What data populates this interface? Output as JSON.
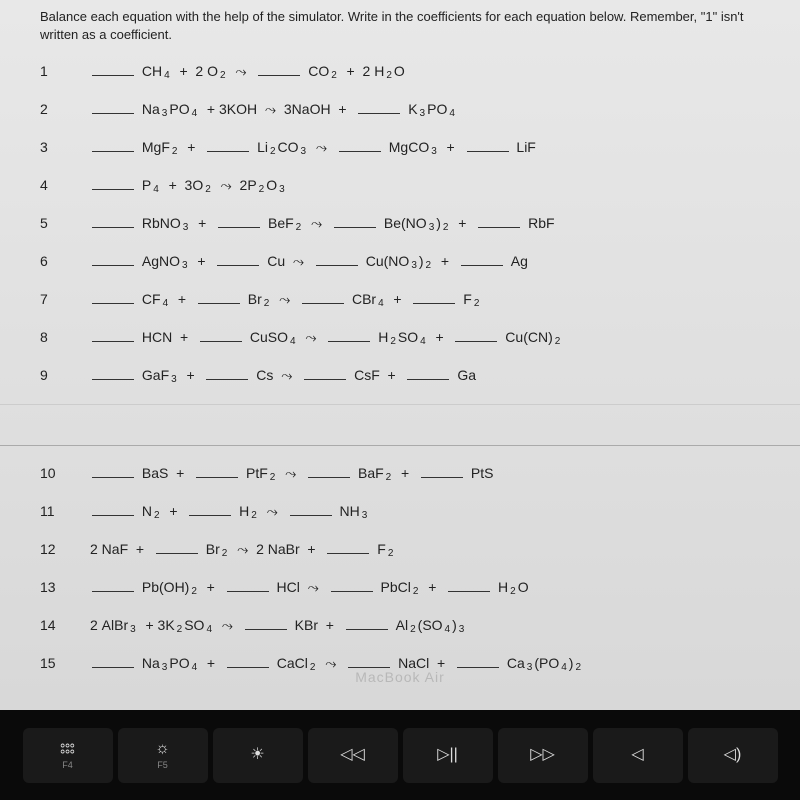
{
  "instructions": "Balance each equation with the help of the simulator.  Write in the coefficients for each equation below.  Remember, \"1\" isn't written as a coefficient.",
  "equations": [
    {
      "num": "1",
      "parts": [
        "_",
        " CH",
        {
          "sub": "4"
        },
        "  +  2 O",
        {
          "sub": "2"
        },
        "  →  ",
        "_",
        " CO",
        {
          "sub": "2"
        },
        "  +  2 H",
        {
          "sub": "2"
        },
        "O"
      ]
    },
    {
      "num": "2",
      "parts": [
        "_",
        " Na",
        {
          "sub": "3"
        },
        "PO",
        {
          "sub": "4"
        },
        "  + 3KOH  →  3NaOH  +  ",
        "_",
        " K",
        {
          "sub": "3"
        },
        "PO",
        {
          "sub": "4"
        }
      ]
    },
    {
      "num": "3",
      "parts": [
        "_",
        " MgF",
        {
          "sub": "2"
        },
        "  +  ",
        "_",
        " Li",
        {
          "sub": "2"
        },
        "CO",
        {
          "sub": "3"
        },
        "  →  ",
        "_",
        " MgCO",
        {
          "sub": "3"
        },
        "  +  ",
        "_",
        " LiF"
      ]
    },
    {
      "num": "4",
      "parts": [
        "_",
        " P",
        {
          "sub": "4"
        },
        "  +  3O",
        {
          "sub": "2"
        },
        "  →  2P",
        {
          "sub": "2"
        },
        "O",
        {
          "sub": "3"
        }
      ]
    },
    {
      "num": "5",
      "parts": [
        "_",
        " RbNO",
        {
          "sub": "3"
        },
        "  +  ",
        "_",
        " BeF",
        {
          "sub": "2"
        },
        "  →  ",
        "_",
        " Be(NO",
        {
          "sub": "3"
        },
        ")",
        {
          "sub": "2"
        },
        "  +  ",
        "_",
        " RbF"
      ]
    },
    {
      "num": "6",
      "parts": [
        "_",
        " AgNO",
        {
          "sub": "3"
        },
        "  +  ",
        "_",
        " Cu  →  ",
        "_",
        " Cu(NO",
        {
          "sub": "3"
        },
        ")",
        {
          "sub": "2"
        },
        "  +  ",
        "_",
        " Ag"
      ]
    },
    {
      "num": "7",
      "parts": [
        "_",
        " CF",
        {
          "sub": "4"
        },
        "  +  ",
        "_",
        " Br",
        {
          "sub": "2"
        },
        "  →  ",
        "_",
        " CBr",
        {
          "sub": "4"
        },
        "  +  ",
        "_",
        " F",
        {
          "sub": "2"
        }
      ]
    },
    {
      "num": "8",
      "parts": [
        "_",
        " HCN  +  ",
        "_",
        " CuSO",
        {
          "sub": "4"
        },
        "  →  ",
        "_",
        " H",
        {
          "sub": "2"
        },
        "SO",
        {
          "sub": "4"
        },
        "  +  ",
        "_",
        " Cu(CN)",
        {
          "sub": "2"
        }
      ]
    },
    {
      "num": "9",
      "parts": [
        "_",
        " GaF",
        {
          "sub": "3"
        },
        "  +  ",
        "_",
        " Cs  →  ",
        "_",
        " CsF  +  ",
        "_",
        " Ga"
      ]
    }
  ],
  "equations2": [
    {
      "num": "10",
      "parts": [
        "_",
        " BaS  +  ",
        "_",
        " PtF",
        {
          "sub": "2"
        },
        "  →  ",
        "_",
        " BaF",
        {
          "sub": "2"
        },
        "  +  ",
        "_",
        " PtS"
      ]
    },
    {
      "num": "11",
      "parts": [
        "_",
        " N",
        {
          "sub": "2"
        },
        "  +  ",
        "_",
        " H",
        {
          "sub": "2"
        },
        "  →  ",
        "_",
        " NH",
        {
          "sub": "3"
        }
      ]
    },
    {
      "num": "12",
      "parts": [
        "2 NaF  +  ",
        "_",
        " Br",
        {
          "sub": "2"
        },
        "  →  2 NaBr  +  ",
        "_",
        " F",
        {
          "sub": "2"
        }
      ]
    },
    {
      "num": "13",
      "parts": [
        "_",
        " Pb(OH)",
        {
          "sub": "2"
        },
        "  +  ",
        "_",
        " HCl  →  ",
        "_",
        " PbCl",
        {
          "sub": "2"
        },
        "  +  ",
        "_",
        " H",
        {
          "sub": "2"
        },
        "O"
      ]
    },
    {
      "num": "14",
      "parts": [
        "2 AlBr",
        {
          "sub": "3"
        },
        "  + 3K",
        {
          "sub": "2"
        },
        "SO",
        {
          "sub": "4"
        },
        "  →  ",
        "_",
        " KBr  +  ",
        "_",
        " Al",
        {
          "sub": "2"
        },
        "(SO",
        {
          "sub": "4"
        },
        ")",
        {
          "sub": "3"
        }
      ]
    },
    {
      "num": "15",
      "parts": [
        "_",
        " Na",
        {
          "sub": "3"
        },
        "PO",
        {
          "sub": "4"
        },
        "  +  ",
        "_",
        " CaCl",
        {
          "sub": "2"
        },
        "  →  ",
        "_",
        " NaCl  +  ",
        "_",
        " Ca",
        {
          "sub": "3"
        },
        "(PO",
        {
          "sub": "4"
        },
        ")",
        {
          "sub": "2"
        }
      ]
    }
  ],
  "macbook": "MacBook Air",
  "keys": [
    {
      "icon": "⦂⦂⦂",
      "label": "F4"
    },
    {
      "icon": "☼",
      "label": "F5"
    },
    {
      "icon": "☀",
      "label": ""
    },
    {
      "icon": "◁◁",
      "label": ""
    },
    {
      "icon": "▷||",
      "label": ""
    },
    {
      "icon": "▷▷",
      "label": ""
    },
    {
      "icon": "◁",
      "label": ""
    },
    {
      "icon": "◁)",
      "label": ""
    }
  ]
}
